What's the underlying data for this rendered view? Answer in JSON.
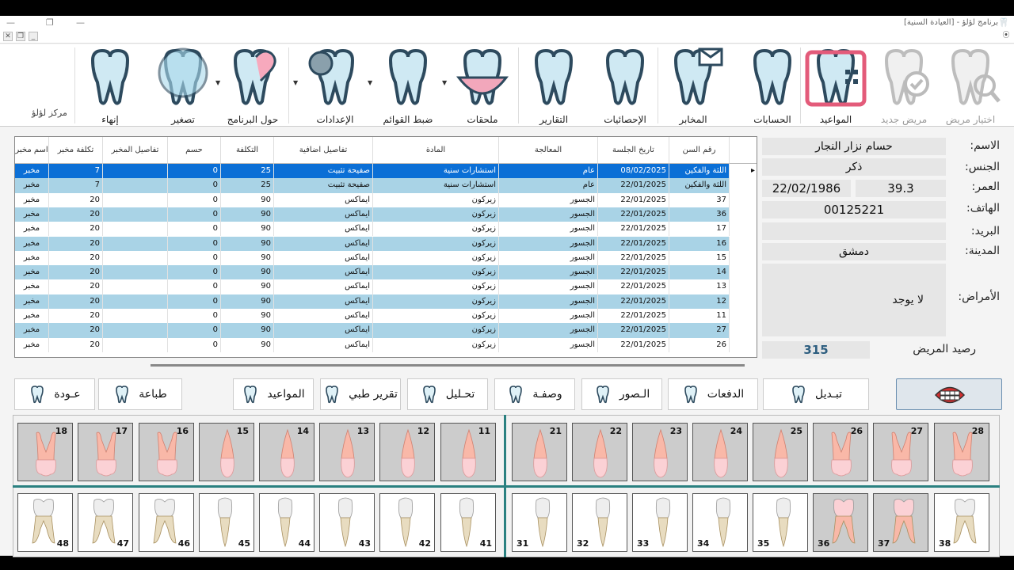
{
  "window": {
    "title": "برنامج لؤلؤ - [العيادة السنية]"
  },
  "brand": "مركز لؤلؤ",
  "ribbon": [
    {
      "label": "اختيار مريض",
      "icon": "tooth-search-icon",
      "dim": true
    },
    {
      "label": "مريض جديد",
      "icon": "tooth-check-icon",
      "dim": true
    },
    {
      "label": "المواعيد",
      "icon": "calendar-tooth-icon",
      "dim": false
    },
    {
      "label": "الحسابات",
      "icon": "dental-chair-icon",
      "dim": false
    },
    {
      "label": "المخابر",
      "icon": "tooth-mail-icon",
      "dim": false
    },
    {
      "label": "الإحصائيات",
      "icon": "dentist-icon",
      "dim": false
    },
    {
      "label": "التقارير",
      "icon": "clipboard-tooth-icon",
      "dim": false
    },
    {
      "label": "ملحقات",
      "icon": "tooth-crown-icon",
      "dim": false
    },
    {
      "label": "ضبط القوائم",
      "icon": "checklist-tooth-icon",
      "dim": false
    },
    {
      "label": "الإعدادات",
      "icon": "gear-tooth-icon",
      "dim": false
    },
    {
      "label": "حول البرنامج",
      "icon": "heart-tooth-icon",
      "dim": false
    },
    {
      "label": "تصغير",
      "icon": "tooth-pin-icon",
      "dim": false
    },
    {
      "label": "إنهاء",
      "icon": "shining-tooth-icon",
      "dim": false
    }
  ],
  "table": {
    "headers": [
      "رقم السن",
      "تاريخ الجلسة",
      "المعالجة",
      "المادة",
      "تفاصيل اضافية",
      "التكلفة",
      "حسم",
      "تفاصيل المخبر",
      "تكلفة مخبر",
      "اسم مخبر"
    ],
    "rows": [
      [
        "اللثة والفكين",
        "08/02/2025",
        "عام",
        "استشارات سنية",
        "صفيحة تثبيت",
        "25",
        "0",
        "",
        "7",
        "مخبر"
      ],
      [
        "اللثة والفكين",
        "22/01/2025",
        "عام",
        "استشارات سنية",
        "صفيحة تثبيت",
        "25",
        "0",
        "",
        "7",
        "مخبر"
      ],
      [
        "37",
        "22/01/2025",
        "الجسور",
        "زيركون",
        "ايماكس",
        "90",
        "0",
        "",
        "20",
        "مخبر"
      ],
      [
        "36",
        "22/01/2025",
        "الجسور",
        "زيركون",
        "ايماكس",
        "90",
        "0",
        "",
        "20",
        "مخبر"
      ],
      [
        "17",
        "22/01/2025",
        "الجسور",
        "زيركون",
        "ايماكس",
        "90",
        "0",
        "",
        "20",
        "مخبر"
      ],
      [
        "16",
        "22/01/2025",
        "الجسور",
        "زيركون",
        "ايماكس",
        "90",
        "0",
        "",
        "20",
        "مخبر"
      ],
      [
        "15",
        "22/01/2025",
        "الجسور",
        "زيركون",
        "ايماكس",
        "90",
        "0",
        "",
        "20",
        "مخبر"
      ],
      [
        "14",
        "22/01/2025",
        "الجسور",
        "زيركون",
        "ايماكس",
        "90",
        "0",
        "",
        "20",
        "مخبر"
      ],
      [
        "13",
        "22/01/2025",
        "الجسور",
        "زيركون",
        "ايماكس",
        "90",
        "0",
        "",
        "20",
        "مخبر"
      ],
      [
        "12",
        "22/01/2025",
        "الجسور",
        "زيركون",
        "ايماكس",
        "90",
        "0",
        "",
        "20",
        "مخبر"
      ],
      [
        "11",
        "22/01/2025",
        "الجسور",
        "زيركون",
        "ايماكس",
        "90",
        "0",
        "",
        "20",
        "مخبر"
      ],
      [
        "27",
        "22/01/2025",
        "الجسور",
        "زيركون",
        "ايماكس",
        "90",
        "0",
        "",
        "20",
        "مخبر"
      ],
      [
        "26",
        "22/01/2025",
        "الجسور",
        "زيركون",
        "ايماكس",
        "90",
        "0",
        "",
        "20",
        "مخبر"
      ]
    ]
  },
  "patient": {
    "name_label": "الاسم:",
    "name": "حسام نزار النجار",
    "gender_label": "الجنس:",
    "gender": "ذكر",
    "age_label": "العمر:",
    "birthdate": "22/02/1986",
    "age": "39.3",
    "phone_label": "الهاتف:",
    "phone": "00125221",
    "email_label": "البريد:",
    "email": "",
    "city_label": "المدينة:",
    "city": "دمشق",
    "diseases_label": "الأمراض:",
    "diseases": "لا يوجد",
    "balance_label": "رصيد المريض",
    "balance": "315"
  },
  "actions": [
    {
      "label": "عـودة",
      "icon": "shining-tooth-icon"
    },
    {
      "label": "طباعة",
      "icon": "tooth-icon"
    },
    {
      "label": "المواعيد",
      "icon": "tooth-chat-icon"
    },
    {
      "label": "تقرير طبي",
      "icon": "tooth-chat-icon"
    },
    {
      "label": "تحـليل",
      "icon": "tooth-sparkle-icon"
    },
    {
      "label": "وصفـة",
      "icon": "tooth-plus-icon"
    },
    {
      "label": "الـصور",
      "icon": "tooth-xray-icon"
    },
    {
      "label": "الدفعات",
      "icon": "tooth-implant-icon"
    },
    {
      "label": "تبـديل",
      "icon": "tooth-refresh-icon"
    }
  ],
  "colors": {
    "selected_row": "#0b6fd6",
    "alt_row": "#a9d3e6",
    "row": "#ffffff",
    "divider": "#2a8080"
  },
  "teeth": {
    "upper": [
      "18",
      "17",
      "16",
      "15",
      "14",
      "13",
      "12",
      "11",
      "21",
      "22",
      "23",
      "24",
      "25",
      "26",
      "27",
      "28"
    ],
    "lower": [
      "48",
      "47",
      "46",
      "45",
      "44",
      "43",
      "42",
      "41",
      "31",
      "32",
      "33",
      "34",
      "35",
      "36",
      "37",
      "38"
    ],
    "highlighted": [
      "18",
      "17",
      "16",
      "15",
      "14",
      "13",
      "12",
      "11",
      "21",
      "22",
      "23",
      "24",
      "25",
      "26",
      "27",
      "28",
      "36",
      "37"
    ]
  }
}
